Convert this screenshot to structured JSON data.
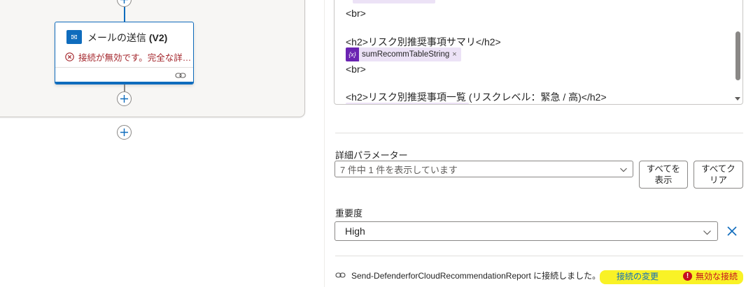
{
  "canvas": {
    "action_card": {
      "icon": "outlook-icon",
      "title": "メールの送信 ",
      "title_version": "(V2)",
      "error_text": "接続が無効です。完全な詳…"
    }
  },
  "panel": {
    "editor": {
      "line_br_top": "<br>",
      "line_h2_summary": "<h2>リスク別推奨事項サマリ</h2>",
      "token_label": "sumRecommTableString",
      "token_icon_text": "{x}",
      "line_br_mid": "<br>",
      "line_h2_list": "<h2>リスク別推奨事項一覧 (リスクレベル：緊急 / 高)</h2>"
    },
    "advanced": {
      "label": "詳細パラメーター",
      "select_value": "7 件中 1 件を表示しています",
      "show_all_line1": "すべてを",
      "show_all_line2": "表示",
      "clear_all_line1": "すべてク",
      "clear_all_line2": "リア"
    },
    "importance": {
      "label": "重要度",
      "value": "High"
    },
    "connection": {
      "text": "Send-DefenderforCloudRecommendationReport に接続しました。",
      "change_link": "接続の変更",
      "invalid_text": "無効な接続",
      "invalid_icon_text": "!"
    }
  },
  "colors": {
    "accent": "#0f6cbd",
    "error": "#c50f1f",
    "token": "#6b24b2",
    "highlight": "#f8f000"
  }
}
